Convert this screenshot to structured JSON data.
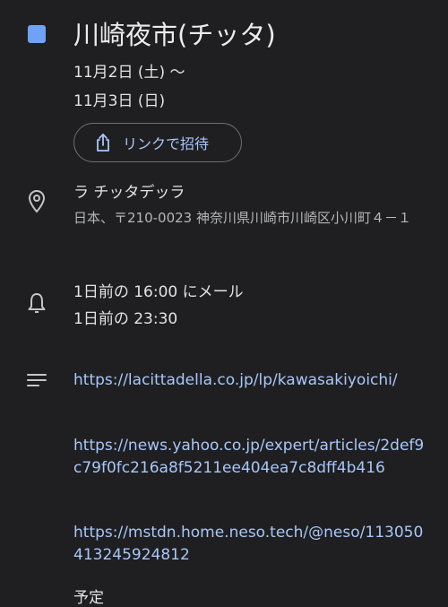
{
  "event": {
    "color": "#6ea2f7",
    "title": "川崎夜市(チッタ)",
    "date_start": "11月2日 (土) 〜",
    "date_end": "11月3日 (日)"
  },
  "invite": {
    "icon": "share-icon",
    "label": "リンクで招待"
  },
  "location": {
    "icon": "location-pin-icon",
    "name": "ラ チッタデッラ",
    "address": "日本、〒210-0023 神奈川県川崎市川崎区小川町４－１"
  },
  "reminders": {
    "icon": "bell-icon",
    "items": [
      "1日前の 16:00 にメール",
      "1日前の 23:30"
    ]
  },
  "description": {
    "icon": "description-lines-icon",
    "links": [
      "https://lacittadella.co.jp/lp/kawasakiyoichi/",
      "https://news.yahoo.co.jp/expert/articles/2def9c79f0fc216a8f5211ee404ea7c8dff4b416",
      "https://mstdn.home.neso.tech/@neso/113050413245924812"
    ],
    "trailing_text": "予定"
  }
}
